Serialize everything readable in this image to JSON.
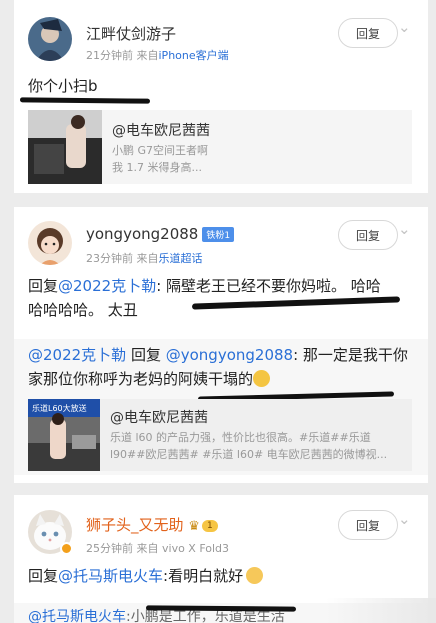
{
  "comments": [
    {
      "username": "江畔仗剑游子",
      "time": "21分钟前",
      "source_prefix": "来自",
      "source": "iPhone客户端",
      "reply_label": "回复",
      "text": "你个小扫b",
      "link_card": {
        "title": "@电车欧尼茜茜",
        "desc": "小鹏 G7空间王者啊\n我 1.7 米得身高..."
      }
    },
    {
      "username": "yongyong2088",
      "badge": "铁粉1",
      "time": "23分钟前",
      "source_prefix": "来自",
      "source": "乐道超话",
      "reply_label": "回复",
      "reply_prefix": "回复",
      "mention": "@2022克卜勒",
      "text_line1_rest": ": 隔壁老王已经不要你妈啦。 哈哈",
      "text_line2": "哈哈哈哈。 太丑",
      "quote_mention1": "@2022克卜勒",
      "quote_mid": " 回复 ",
      "quote_mention2": "@yongyong2088",
      "quote_line1_rest": ": 那一定是我干你",
      "quote_line2": "家那位你称呼为老妈的阿姨干塌的",
      "link_card": {
        "title": "@电车欧尼茜茜",
        "thumb_text": "乐道L60大放送",
        "desc": "乐道 l60 的产品力强，性价比也很高。#乐道##乐道\nl90##欧尼茜茜# #乐道 l60# 电车欧尼茜茜的微博视..."
      }
    },
    {
      "username": "狮子头_又无助",
      "badge": "1",
      "time": "25分钟前",
      "source_prefix": "来自",
      "source": "vivo X Fold3",
      "reply_label": "回复",
      "reply_prefix": "回复",
      "mention": "@托马斯电火车",
      "text_rest": ":看明白就好",
      "cut_mention": "@托马斯电火车",
      "cut_rest": ":小鹏是工作，乐道是生活"
    }
  ]
}
